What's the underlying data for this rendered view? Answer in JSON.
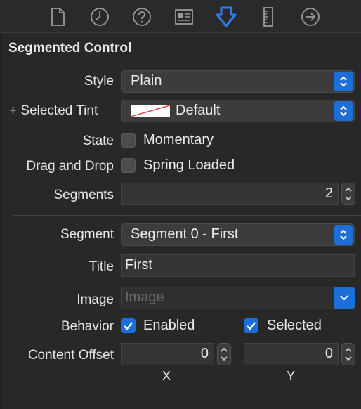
{
  "tabs": [
    {
      "icon": "file-icon"
    },
    {
      "icon": "clock-icon"
    },
    {
      "icon": "help-icon"
    },
    {
      "icon": "identity-card-icon"
    },
    {
      "icon": "attributes-inspector-icon",
      "selected": true
    },
    {
      "icon": "ruler-icon"
    },
    {
      "icon": "connections-arrow-icon"
    }
  ],
  "section_title": "Segmented Control",
  "style": {
    "label": "Style",
    "value": "Plain"
  },
  "selected_tint": {
    "plus": "+",
    "label": "Selected Tint",
    "value": "Default"
  },
  "state": {
    "label": "State",
    "option": "Momentary",
    "checked": false
  },
  "drag_drop": {
    "label": "Drag and Drop",
    "option": "Spring Loaded",
    "checked": false
  },
  "segments": {
    "label": "Segments",
    "value": "2"
  },
  "segment": {
    "label": "Segment",
    "value": "Segment 0 - First"
  },
  "title": {
    "label": "Title",
    "value": "First"
  },
  "image": {
    "label": "Image",
    "placeholder": "Image"
  },
  "behavior": {
    "label": "Behavior",
    "enabled_label": "Enabled",
    "enabled": true,
    "selected_label": "Selected",
    "selected": true
  },
  "content_offset": {
    "label": "Content Offset",
    "x_value": "0",
    "y_value": "0",
    "x_label": "X",
    "y_label": "Y"
  },
  "colors": {
    "accent": "#1d6fd8",
    "selected_tab": "#2f7ef0",
    "background": "#282828"
  }
}
